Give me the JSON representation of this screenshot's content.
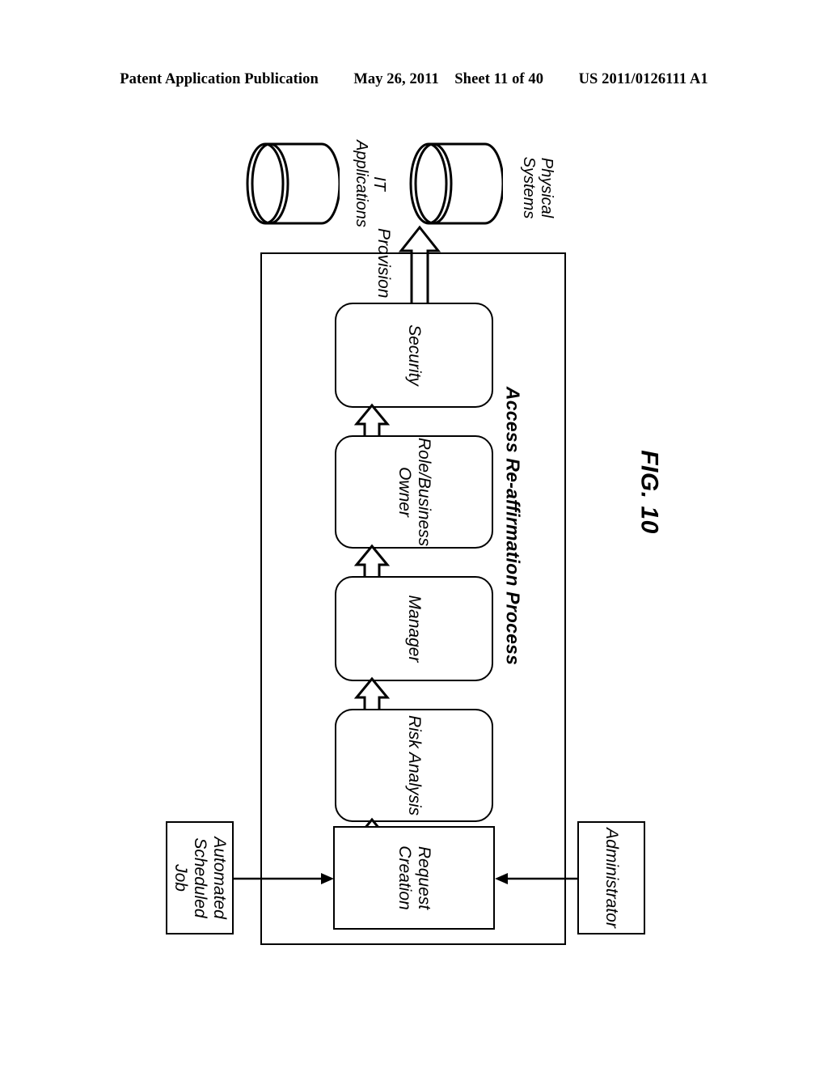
{
  "header": {
    "publication": "Patent Application Publication",
    "date": "May 26, 2011",
    "sheet": "Sheet 11 of 40",
    "document_number": "US 2011/0126111 A1"
  },
  "figure": {
    "number": "FIG. 10",
    "process_title": "Access Re-affirmation Process"
  },
  "flow": {
    "stages": [
      {
        "id": "request-creation",
        "label": "Request\nCreation"
      },
      {
        "id": "risk-analysis",
        "label": "Risk Analysis"
      },
      {
        "id": "manager",
        "label": "Manager"
      },
      {
        "id": "role-business-owner",
        "label": "Role/Business\nOwner"
      },
      {
        "id": "security",
        "label": "Security"
      }
    ],
    "actors": [
      {
        "id": "automated-scheduled-job",
        "label": "Automated\nScheduled\nJob"
      },
      {
        "id": "administrator",
        "label": "Administrator"
      }
    ],
    "targets": [
      {
        "id": "it-applications",
        "label": "IT\nApplications"
      },
      {
        "id": "physical-systems",
        "label": "Physical\nSystems"
      }
    ],
    "edges": [
      {
        "id": "provision-edge",
        "label": "Provision"
      }
    ]
  },
  "colors": {
    "stroke": "#000000",
    "fill": "#ffffff"
  }
}
